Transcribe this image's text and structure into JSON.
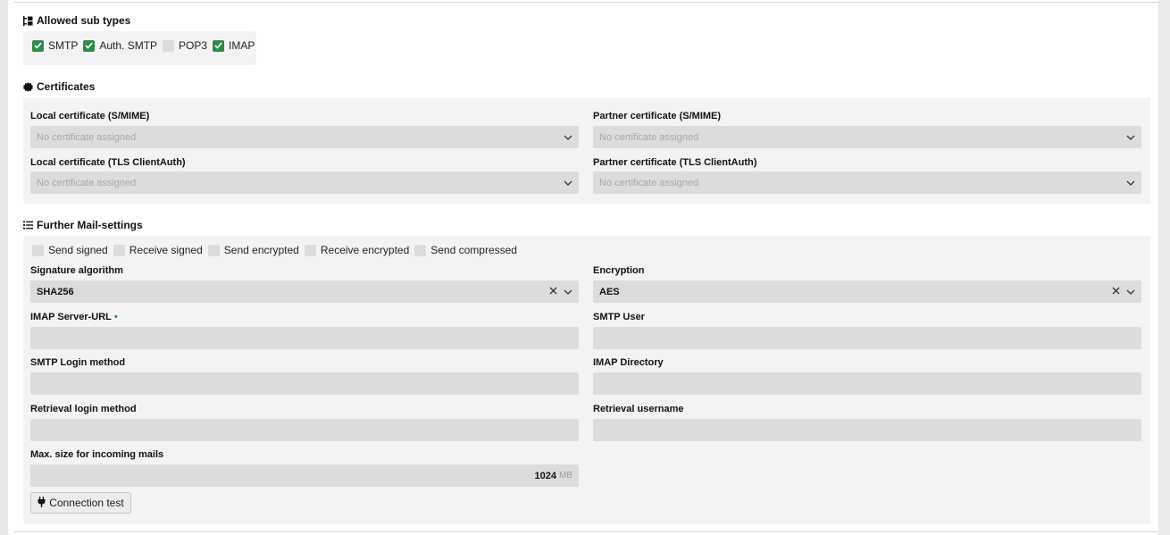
{
  "subtypes": {
    "title": "Allowed sub types",
    "items": [
      {
        "label": "SMTP",
        "checked": true
      },
      {
        "label": "Auth. SMTP",
        "checked": true
      },
      {
        "label": "POP3",
        "checked": false
      },
      {
        "label": "IMAP",
        "checked": true
      }
    ]
  },
  "certificates": {
    "title": "Certificates",
    "local_smime_label": "Local certificate (S/MIME)",
    "local_smime_placeholder": "No certificate assigned",
    "partner_smime_label": "Partner certificate (S/MIME)",
    "partner_smime_placeholder": "No certificate assigned",
    "local_tls_label": "Local certificate (TLS ClientAuth)",
    "local_tls_placeholder": "No certificate assigned",
    "partner_tls_label": "Partner certificate (TLS ClientAuth)",
    "partner_tls_placeholder": "No certificate assigned"
  },
  "mail": {
    "title": "Further Mail-settings",
    "options": [
      {
        "label": "Send signed",
        "checked": false
      },
      {
        "label": "Receive signed",
        "checked": false
      },
      {
        "label": "Send encrypted",
        "checked": false
      },
      {
        "label": "Receive encrypted",
        "checked": false
      },
      {
        "label": "Send compressed",
        "checked": false
      }
    ],
    "signature_label": "Signature algorithm",
    "signature_value": "SHA256",
    "encryption_label": "Encryption",
    "encryption_value": "AES",
    "imap_url_label": "IMAP Server-URL",
    "imap_url_required": "•",
    "smtp_user_label": "SMTP User",
    "smtp_login_label": "SMTP Login method",
    "imap_dir_label": "IMAP Directory",
    "retrieval_login_label": "Retrieval login method",
    "retrieval_user_label": "Retrieval username",
    "max_size_label": "Max. size for incoming mails",
    "max_size_value": "1024",
    "max_size_unit": "MB",
    "connection_test_label": "Connection test"
  },
  "icons": {
    "subtypes": "hierarchy-icon",
    "certificates": "certificate-seal-icon",
    "mail": "list-icon",
    "dropdown": "chevron-down-icon",
    "clear": "clear-icon",
    "button": "plug-icon"
  },
  "colors": {
    "accent": "#2f8a4c",
    "field_bg": "#dcdcdc",
    "section_bg": "#f3f3f3"
  }
}
